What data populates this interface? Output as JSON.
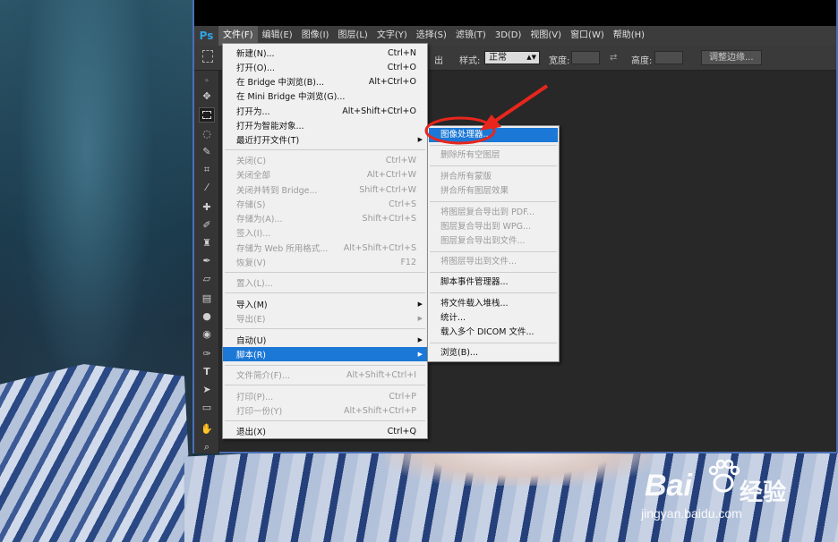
{
  "menubar": {
    "logo": "Ps",
    "items": [
      "文件(F)",
      "编辑(E)",
      "图像(I)",
      "图层(L)",
      "文字(Y)",
      "选择(S)",
      "滤镜(T)",
      "3D(D)",
      "视图(V)",
      "窗口(W)",
      "帮助(H)"
    ],
    "active_index": 0
  },
  "options_bar": {
    "feather_partial": "出",
    "style_label": "样式:",
    "style_value": "正常",
    "width_label": "宽度:",
    "height_label": "高度:",
    "refine_edge_button": "调整边缘..."
  },
  "file_menu": {
    "items": [
      {
        "label": "新建(N)...",
        "shortcut": "Ctrl+N",
        "disabled": false
      },
      {
        "label": "打开(O)...",
        "shortcut": "Ctrl+O",
        "disabled": false
      },
      {
        "label": "在 Bridge 中浏览(B)...",
        "shortcut": "Alt+Ctrl+O",
        "disabled": false
      },
      {
        "label": "在 Mini Bridge 中浏览(G)...",
        "shortcut": "",
        "disabled": false
      },
      {
        "label": "打开为...",
        "shortcut": "Alt+Shift+Ctrl+O",
        "disabled": false
      },
      {
        "label": "打开为智能对象...",
        "shortcut": "",
        "disabled": false
      },
      {
        "label": "最近打开文件(T)",
        "shortcut": "",
        "disabled": false,
        "submenu": true
      },
      {
        "label": "关闭(C)",
        "shortcut": "Ctrl+W",
        "disabled": true
      },
      {
        "label": "关闭全部",
        "shortcut": "Alt+Ctrl+W",
        "disabled": true
      },
      {
        "label": "关闭并转到 Bridge...",
        "shortcut": "Shift+Ctrl+W",
        "disabled": true
      },
      {
        "label": "存储(S)",
        "shortcut": "Ctrl+S",
        "disabled": true
      },
      {
        "label": "存储为(A)...",
        "shortcut": "Shift+Ctrl+S",
        "disabled": true
      },
      {
        "label": "签入(I)...",
        "shortcut": "",
        "disabled": true
      },
      {
        "label": "存储为 Web 所用格式...",
        "shortcut": "Alt+Shift+Ctrl+S",
        "disabled": true
      },
      {
        "label": "恢复(V)",
        "shortcut": "F12",
        "disabled": true
      },
      {
        "label": "置入(L)...",
        "shortcut": "",
        "disabled": true
      },
      {
        "label": "导入(M)",
        "shortcut": "",
        "disabled": false,
        "submenu": true
      },
      {
        "label": "导出(E)",
        "shortcut": "",
        "disabled": true,
        "submenu": true
      },
      {
        "label": "自动(U)",
        "shortcut": "",
        "disabled": false,
        "submenu": true
      },
      {
        "label": "脚本(R)",
        "shortcut": "",
        "disabled": false,
        "submenu": true,
        "highlighted": true
      },
      {
        "label": "文件简介(F)...",
        "shortcut": "Alt+Shift+Ctrl+I",
        "disabled": true
      },
      {
        "label": "打印(P)...",
        "shortcut": "Ctrl+P",
        "disabled": true
      },
      {
        "label": "打印一份(Y)",
        "shortcut": "Alt+Shift+Ctrl+P",
        "disabled": true
      },
      {
        "label": "退出(X)",
        "shortcut": "Ctrl+Q",
        "disabled": false
      }
    ]
  },
  "scripts_submenu": {
    "items": [
      {
        "label": "图像处理器...",
        "disabled": false,
        "highlighted": true
      },
      {
        "label": "删除所有空图层",
        "disabled": true
      },
      {
        "label": "拼合所有蒙版",
        "disabled": true
      },
      {
        "label": "拼合所有图层效果",
        "disabled": true
      },
      {
        "label": "将图层复合导出到 PDF...",
        "disabled": true
      },
      {
        "label": "图层复合导出到 WPG...",
        "disabled": true
      },
      {
        "label": "图层复合导出到文件...",
        "disabled": true
      },
      {
        "label": "将图层导出到文件...",
        "disabled": true
      },
      {
        "label": "脚本事件管理器...",
        "disabled": false
      },
      {
        "label": "将文件载入堆栈...",
        "disabled": false
      },
      {
        "label": "统计...",
        "disabled": false
      },
      {
        "label": "载入多个 DICOM 文件...",
        "disabled": false
      },
      {
        "label": "浏览(B)...",
        "disabled": false
      }
    ]
  },
  "annotation": {
    "color": "#e8261c"
  },
  "watermark": {
    "brand": "Bai",
    "brand_suffix": "经验",
    "url": "jingyan.baidu.com"
  },
  "colors": {
    "highlight": "#1c78d6",
    "ps_logo": "#2fa3e8",
    "window_border": "#4a6fb5"
  }
}
